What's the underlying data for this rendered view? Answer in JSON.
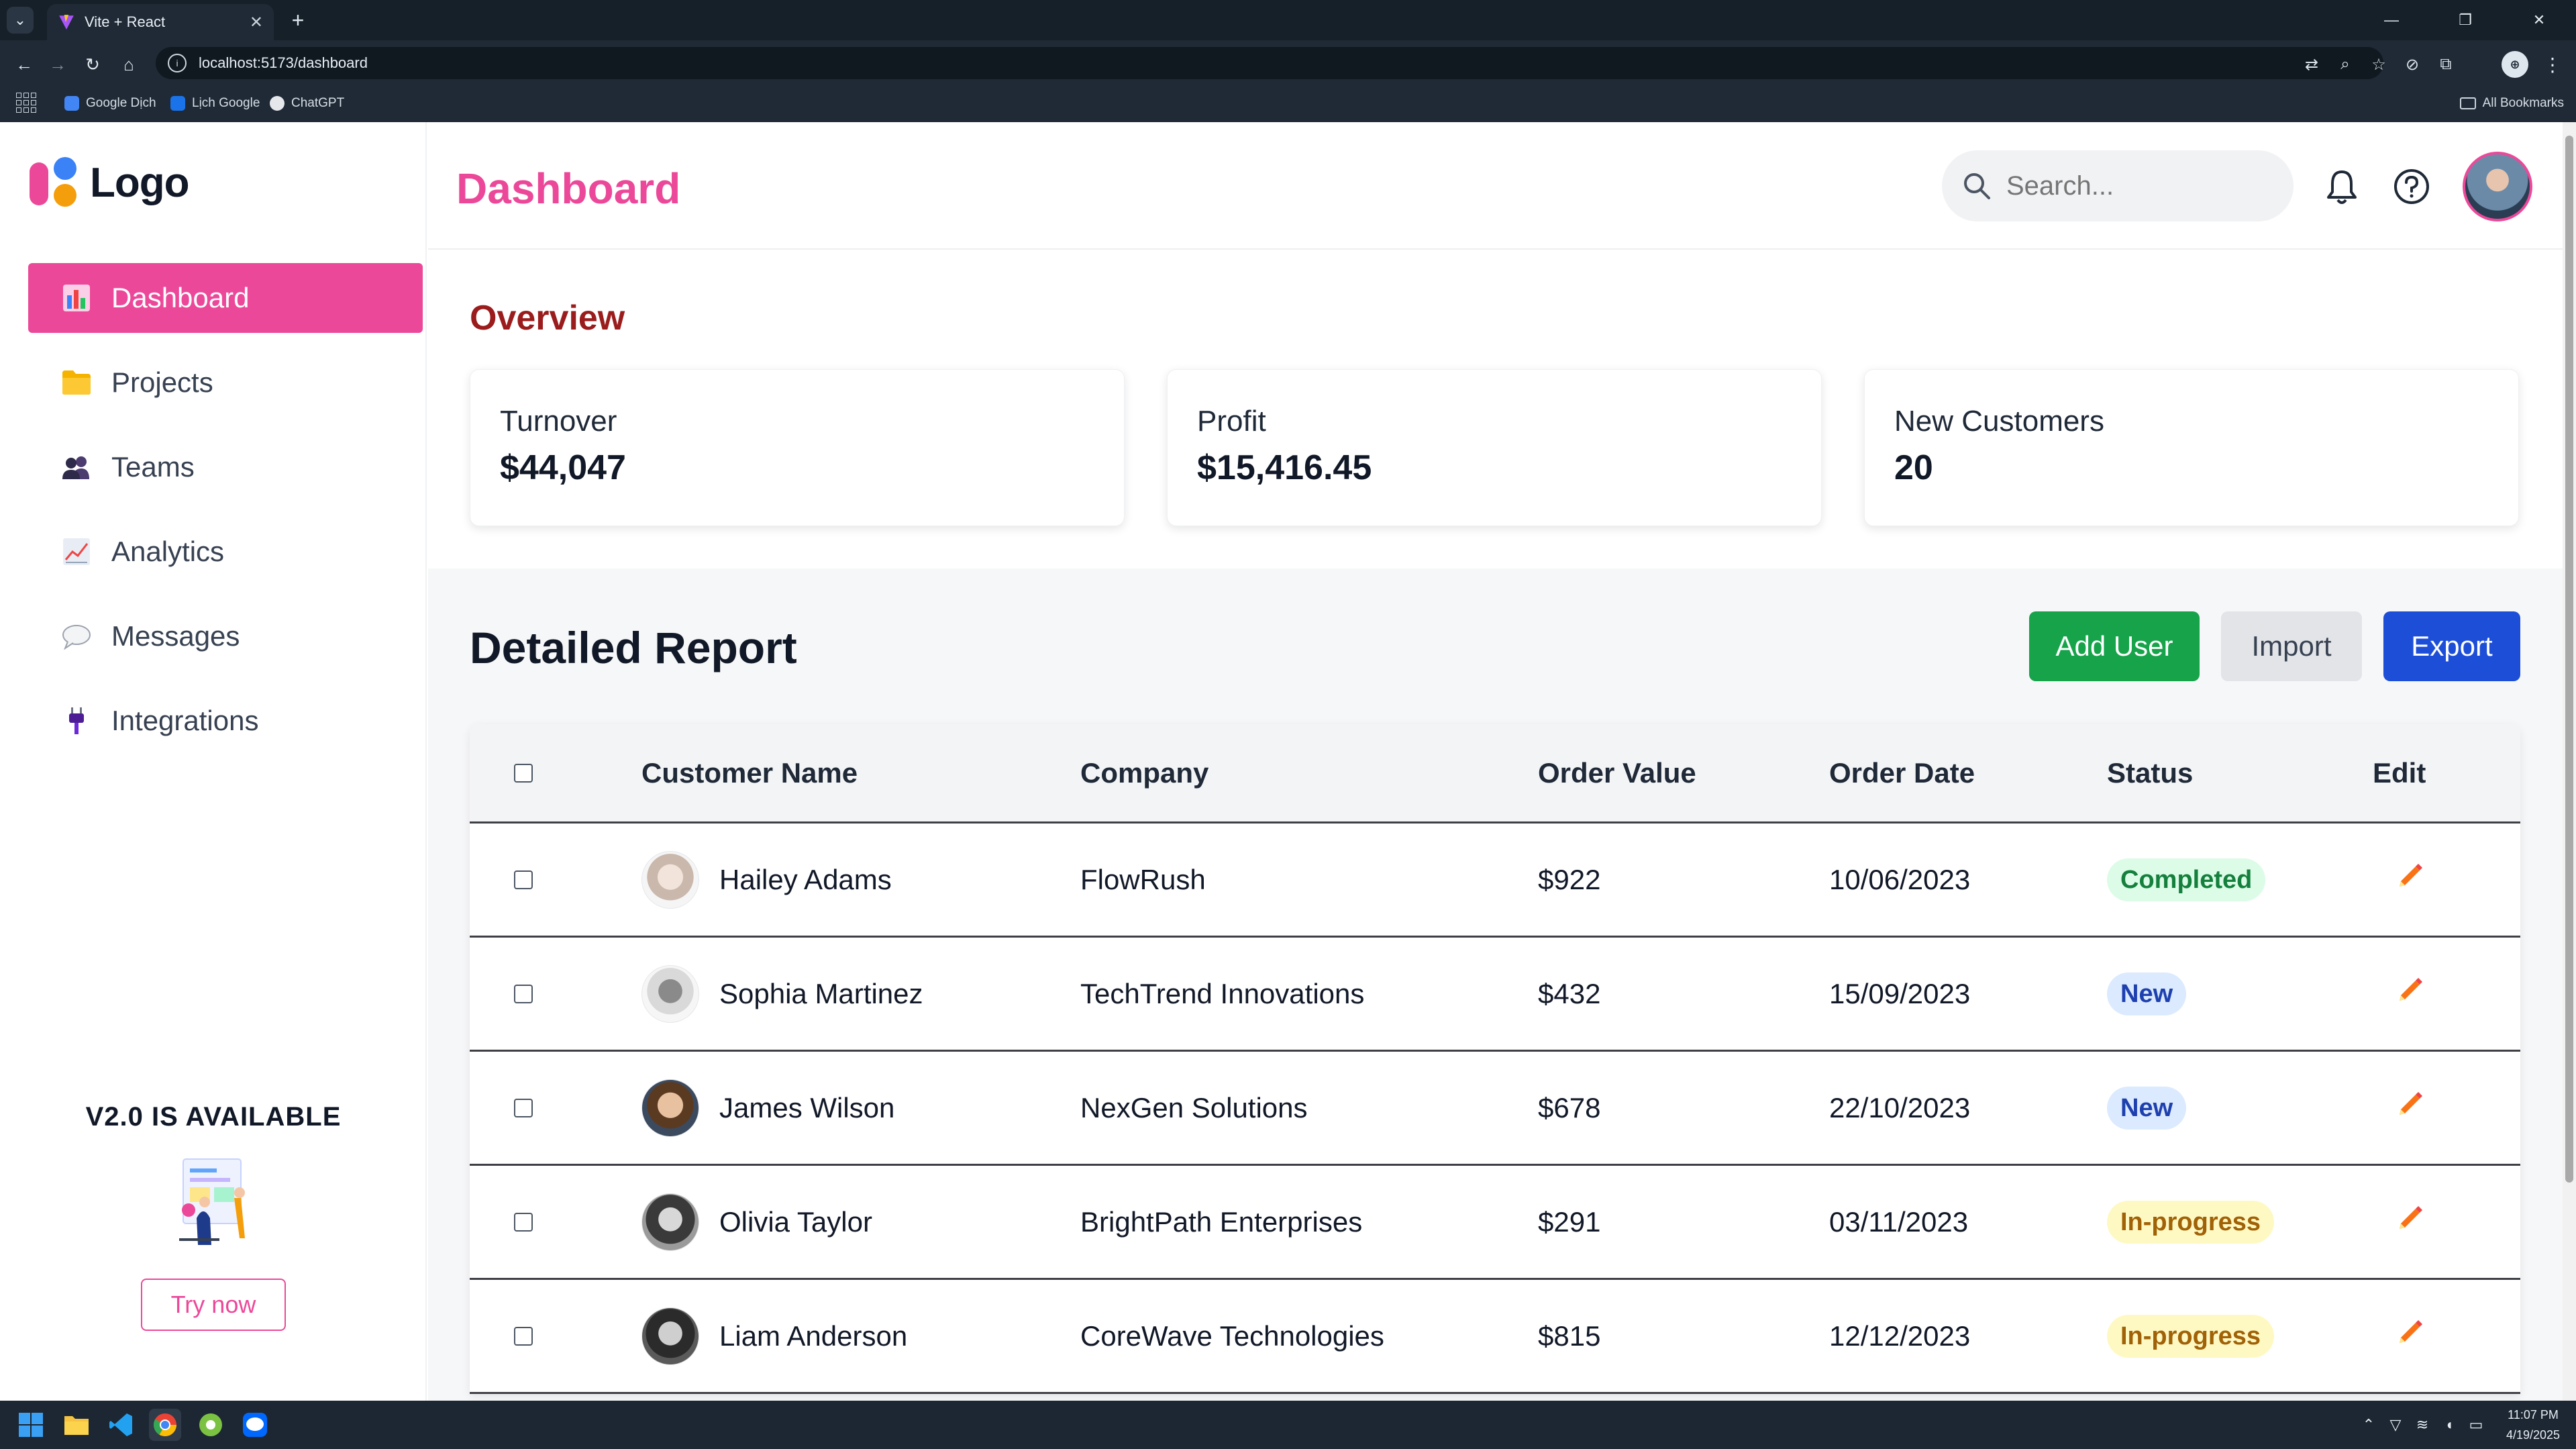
{
  "browser": {
    "tab_title": "Vite + React",
    "url": "localhost:5173/dashboard",
    "bookmarks": [
      "Google Dịch",
      "Lịch Google",
      "ChatGPT"
    ],
    "all_bookmarks": "All Bookmarks"
  },
  "sidebar": {
    "logo_text": "Logo",
    "items": [
      {
        "label": "Dashboard",
        "icon": "bar-chart-icon",
        "active": true
      },
      {
        "label": "Projects",
        "icon": "folder-icon",
        "active": false
      },
      {
        "label": "Teams",
        "icon": "users-icon",
        "active": false
      },
      {
        "label": "Analytics",
        "icon": "trend-chart-icon",
        "active": false
      },
      {
        "label": "Messages",
        "icon": "speech-bubble-icon",
        "active": false
      },
      {
        "label": "Integrations",
        "icon": "plug-icon",
        "active": false
      }
    ],
    "promo": {
      "title": "V2.0 IS AVAILABLE",
      "button": "Try now"
    }
  },
  "header": {
    "title": "Dashboard",
    "search_placeholder": "Search..."
  },
  "overview": {
    "title": "Overview",
    "cards": [
      {
        "label": "Turnover",
        "value": "$44,047"
      },
      {
        "label": "Profit",
        "value": "$15,416.45"
      },
      {
        "label": "New Customers",
        "value": "20"
      }
    ]
  },
  "report": {
    "title": "Detailed Report",
    "buttons": {
      "add": "Add User",
      "import": "Import",
      "export": "Export"
    },
    "columns": [
      "Customer Name",
      "Company",
      "Order Value",
      "Order Date",
      "Status",
      "Edit"
    ],
    "rows": [
      {
        "name": "Hailey Adams",
        "company": "FlowRush",
        "value": "$922",
        "date": "10/06/2023",
        "status": "Completed"
      },
      {
        "name": "Sophia Martinez",
        "company": "TechTrend Innovations",
        "value": "$432",
        "date": "15/09/2023",
        "status": "New"
      },
      {
        "name": "James Wilson",
        "company": "NexGen Solutions",
        "value": "$678",
        "date": "22/10/2023",
        "status": "New"
      },
      {
        "name": "Olivia Taylor",
        "company": "BrightPath Enterprises",
        "value": "$291",
        "date": "03/11/2023",
        "status": "In-progress"
      },
      {
        "name": "Liam Anderson",
        "company": "CoreWave Technologies",
        "value": "$815",
        "date": "12/12/2023",
        "status": "In-progress"
      }
    ]
  },
  "colors": {
    "accent": "#ec4899",
    "overview_title": "#9b1c1c",
    "add_button": "#16a34a",
    "export_button": "#1d4ed8",
    "status_completed_bg": "#dcfce7",
    "status_completed_fg": "#15803d",
    "status_new_bg": "#dbeafe",
    "status_new_fg": "#1e40af",
    "status_progress_bg": "#fef9c3",
    "status_progress_fg": "#a16207"
  },
  "taskbar": {
    "time": "11:07 PM",
    "date": "4/19/2025"
  }
}
